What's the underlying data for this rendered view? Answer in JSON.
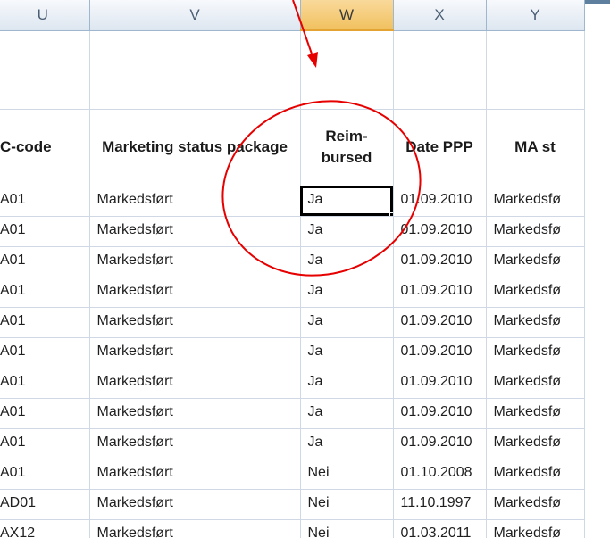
{
  "column_headers": [
    "U",
    "V",
    "W",
    "X",
    "Y"
  ],
  "selected_column": "W",
  "header_row": {
    "u": "C-code",
    "v": "Marketing status package",
    "w": "Reim-bursed",
    "x": "Date PPP",
    "y": "MA st"
  },
  "rows": [
    {
      "u": "A01",
      "v": "Markedsført",
      "w": "Ja",
      "x": "01.09.2010",
      "y": "Markedsfø"
    },
    {
      "u": "A01",
      "v": "Markedsført",
      "w": "Ja",
      "x": "01.09.2010",
      "y": "Markedsfø"
    },
    {
      "u": "A01",
      "v": "Markedsført",
      "w": "Ja",
      "x": "01.09.2010",
      "y": "Markedsfø"
    },
    {
      "u": "A01",
      "v": "Markedsført",
      "w": "Ja",
      "x": "01.09.2010",
      "y": "Markedsfø"
    },
    {
      "u": "A01",
      "v": "Markedsført",
      "w": "Ja",
      "x": "01.09.2010",
      "y": "Markedsfø"
    },
    {
      "u": "A01",
      "v": "Markedsført",
      "w": "Ja",
      "x": "01.09.2010",
      "y": "Markedsfø"
    },
    {
      "u": "A01",
      "v": "Markedsført",
      "w": "Ja",
      "x": "01.09.2010",
      "y": "Markedsfø"
    },
    {
      "u": "A01",
      "v": "Markedsført",
      "w": "Ja",
      "x": "01.09.2010",
      "y": "Markedsfø"
    },
    {
      "u": "A01",
      "v": "Markedsført",
      "w": "Ja",
      "x": "01.09.2010",
      "y": "Markedsfø"
    },
    {
      "u": "A01",
      "v": "Markedsført",
      "w": "Nei",
      "x": "01.10.2008",
      "y": "Markedsfø"
    },
    {
      "u": "AD01",
      "v": "Markedsført",
      "w": "Nei",
      "x": "11.10.1997",
      "y": "Markedsfø"
    },
    {
      "u": "AX12",
      "v": "Markedsført",
      "w": "Nei",
      "x": "01.03.2011",
      "y": "Markedsfø"
    }
  ],
  "annotation": {
    "color": "#e60000",
    "shapes": [
      "red-arrow",
      "red-circle"
    ]
  }
}
